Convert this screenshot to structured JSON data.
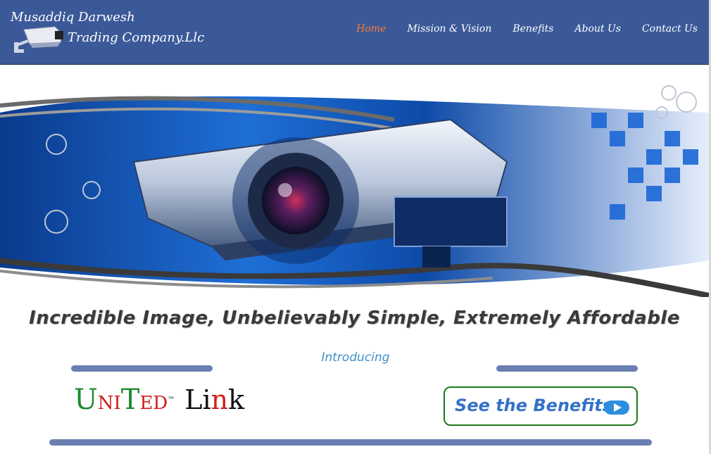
{
  "brand": {
    "line1": "Musaddiq Darwesh",
    "line2": "Trading Company.Llc"
  },
  "nav": {
    "items": [
      {
        "label": "Home",
        "active": true
      },
      {
        "label": "Mission & Vision",
        "active": false
      },
      {
        "label": "Benefits",
        "active": false
      },
      {
        "label": "About Us",
        "active": false
      },
      {
        "label": "Contact Us",
        "active": false
      }
    ]
  },
  "tagline": "Incredible Image, Unbelievably Simple, Extremely Affordable",
  "introducing": "Introducing",
  "product": {
    "u": "U",
    "ni": "NI",
    "t": "T",
    "ed": "ED",
    "tm": "™",
    "li": "Li",
    "n": "n",
    "k": "k"
  },
  "cta": {
    "label": "See the Benefits"
  },
  "icons": {
    "logo": "security-camera-icon",
    "cta": "play-arrow-icon"
  },
  "colors": {
    "header_bg": "#3b5998",
    "nav_active": "#ff7a33",
    "divider": "#6a7fb1",
    "cta_border": "#1a7a1a",
    "cta_text": "#3572c9"
  }
}
